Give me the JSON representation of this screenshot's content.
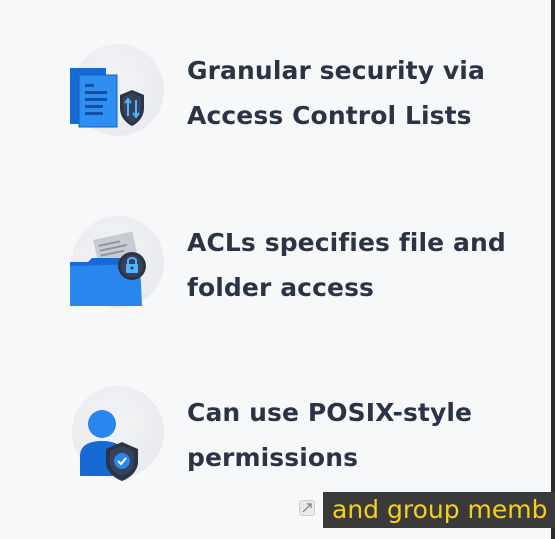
{
  "features": [
    {
      "icon": "document-shield-icon",
      "text": "Granular security via Access Control Lists"
    },
    {
      "icon": "folder-lock-icon",
      "text": "ACLs specifies file and folder access"
    },
    {
      "icon": "user-shield-icon",
      "text": "Can use POSIX-style permissions"
    }
  ],
  "caption": {
    "text": "and group memb"
  },
  "expand_icon": "expand-icon",
  "colors": {
    "text": "#2b3445",
    "accent_blue": "#1a73e8",
    "shield_dark": "#2b3445",
    "caption_text": "#f5cf1b",
    "caption_bg": "#3a3a3a"
  }
}
